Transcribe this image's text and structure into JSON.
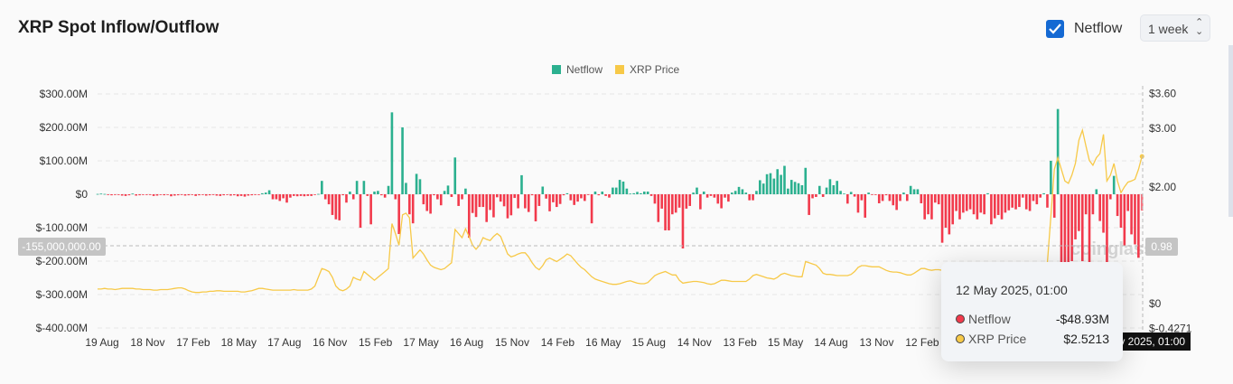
{
  "header": {
    "title": "XRP Spot Inflow/Outflow",
    "netflow_checkbox_label": "Netflow",
    "netflow_checked": true,
    "interval_select": "1 week"
  },
  "colors": {
    "positive": "#2bb08f",
    "negative": "#f23a4c",
    "price": "#f7c948",
    "checkbox": "#1469d3"
  },
  "watermark": "coinglass",
  "crosshair": {
    "left_label": "-155,000,000.00",
    "right_label": "0.98",
    "x_label": "12 May 2025, 01:00"
  },
  "tooltip": {
    "date": "12 May 2025, 01:00",
    "rows": [
      {
        "label": "Netflow",
        "value": "-$48.93M",
        "color": "#f23a4c"
      },
      {
        "label": "XRP Price",
        "value": "$2.5213",
        "color": "#f7c948"
      }
    ]
  },
  "chart_data": {
    "type": "bar+line",
    "legend": [
      {
        "name": "Netflow",
        "color": "#2bb08f"
      },
      {
        "name": "XRP Price",
        "color": "#f7c948"
      }
    ],
    "legend_position": "top-center",
    "grid": true,
    "x_start": "19 Aug 2019",
    "x_interval": "1 week",
    "x_tick_labels": [
      "19 Aug",
      "18 Nov",
      "17 Feb",
      "18 May",
      "17 Aug",
      "16 Nov",
      "15 Feb",
      "17 May",
      "16 Aug",
      "15 Nov",
      "14 Feb",
      "16 May",
      "15 Aug",
      "14 Nov",
      "13 Feb",
      "15 May",
      "14 Aug",
      "13 Nov",
      "12 Feb"
    ],
    "y_left": {
      "unit": "USD millions",
      "range": [
        -400,
        300
      ],
      "ticks": [
        {
          "v": 300,
          "label": "$300.00M"
        },
        {
          "v": 200,
          "label": "$200.00M"
        },
        {
          "v": 100,
          "label": "$100.00M"
        },
        {
          "v": 0,
          "label": "$0"
        },
        {
          "v": -100,
          "label": "$-100.00M"
        },
        {
          "v": -200,
          "label": "$-200.00M"
        },
        {
          "v": -300,
          "label": "$-300.00M"
        },
        {
          "v": -400,
          "label": "$-400.00M"
        }
      ]
    },
    "y_right": {
      "unit": "USD",
      "range": [
        -0.4271,
        3.6
      ],
      "ticks": [
        {
          "v": 3.6,
          "label": "$3.60"
        },
        {
          "v": 3.0,
          "label": "$3.00"
        },
        {
          "v": 2.0,
          "label": "$2.00"
        },
        {
          "v": 0,
          "label": "$0"
        },
        {
          "v": -0.4271,
          "label": "$-0.4271"
        }
      ]
    },
    "series": [
      {
        "name": "Netflow",
        "axis": "left",
        "values": [
          1,
          2,
          1,
          -2,
          -3,
          -2,
          -1,
          -4,
          -5,
          -3,
          2,
          -4,
          -3,
          -1,
          -2,
          -1,
          -5,
          -4,
          -2,
          -3,
          -2,
          -6,
          -4,
          -3,
          -2,
          -4,
          -3,
          -2,
          -5,
          -3,
          -2,
          -4,
          -3,
          -2,
          -4,
          -5,
          -3,
          -2,
          -4,
          -3,
          -6,
          -5,
          -7,
          -4,
          -3,
          -2,
          -1,
          3,
          5,
          12,
          -15,
          -15,
          -20,
          -12,
          -25,
          -10,
          -5,
          -6,
          -5,
          -6,
          -5,
          -5,
          -2,
          1,
          40,
          -15,
          -30,
          -62,
          -75,
          -78,
          -3,
          -25,
          8,
          -15,
          40,
          -100,
          40,
          -5,
          -90,
          8,
          10,
          -3,
          -10,
          25,
          245,
          -15,
          -119,
          200,
          34,
          -60,
          -87,
          61,
          45,
          -30,
          -50,
          -58,
          -3,
          -15,
          -33,
          10,
          26,
          -8,
          110,
          -35,
          -15,
          17,
          -130,
          -56,
          -68,
          -38,
          -38,
          -83,
          -47,
          -69,
          -9,
          -22,
          -36,
          -72,
          -63,
          -11,
          -42,
          57,
          -42,
          -53,
          -3,
          -81,
          -35,
          23,
          -13,
          -51,
          -24,
          -38,
          -29,
          -3,
          3,
          -18,
          -32,
          -22,
          -12,
          -20,
          -2,
          -87,
          8,
          -3,
          8,
          -5,
          -10,
          20,
          20,
          43,
          38,
          17,
          2,
          3,
          7,
          3,
          8,
          8,
          -5,
          -28,
          -83,
          -43,
          -108,
          -108,
          -60,
          -55,
          -40,
          -162,
          -43,
          -35,
          5,
          20,
          -45,
          8,
          -10,
          -5,
          -10,
          -28,
          -42,
          -10,
          -22,
          5,
          10,
          22,
          15,
          5,
          -18,
          -18,
          10,
          42,
          32,
          60,
          63,
          47,
          75,
          58,
          85,
          17,
          43,
          37,
          33,
          27,
          79,
          -62,
          -12,
          -8,
          25,
          -8,
          20,
          45,
          27,
          40,
          10,
          2,
          -28,
          7,
          -7,
          -55,
          -18,
          -70,
          5,
          -2,
          -2,
          -27,
          -20,
          -3,
          -20,
          -33,
          -47,
          -20,
          5,
          -20,
          25,
          15,
          15,
          -27,
          -75,
          -60,
          -75,
          -25,
          -30,
          -145,
          -100,
          -120,
          -90,
          -50,
          -75,
          -55,
          -50,
          -45,
          -60,
          -75,
          -55,
          -60,
          3,
          -90,
          -72,
          -62,
          -75,
          -55,
          -48,
          -40,
          -45,
          -38,
          -10,
          -45,
          -50,
          -20,
          -30,
          -10,
          3,
          -40,
          100,
          -70,
          255,
          -220,
          -210,
          -215,
          -200,
          -135,
          -110,
          -200,
          -60,
          -205,
          -60,
          15,
          -80,
          -115,
          -215,
          -15,
          55,
          -65,
          -100,
          -155,
          -50,
          -120,
          -150,
          -190,
          -48.93
        ]
      },
      {
        "name": "XRP Price",
        "axis": "right",
        "values": [
          0.25,
          0.25,
          0.26,
          0.25,
          0.25,
          0.24,
          0.25,
          0.26,
          0.26,
          0.26,
          0.26,
          0.25,
          0.25,
          0.24,
          0.24,
          0.24,
          0.23,
          0.23,
          0.24,
          0.24,
          0.24,
          0.25,
          0.26,
          0.27,
          0.27,
          0.25,
          0.22,
          0.2,
          0.19,
          0.19,
          0.2,
          0.2,
          0.21,
          0.21,
          0.22,
          0.22,
          0.21,
          0.21,
          0.21,
          0.21,
          0.21,
          0.2,
          0.2,
          0.21,
          0.22,
          0.24,
          0.26,
          0.26,
          0.25,
          0.24,
          0.23,
          0.23,
          0.23,
          0.23,
          0.23,
          0.23,
          0.24,
          0.23,
          0.23,
          0.23,
          0.23,
          0.25,
          0.3,
          0.45,
          0.6,
          0.58,
          0.55,
          0.45,
          0.3,
          0.24,
          0.22,
          0.25,
          0.3,
          0.45,
          0.42,
          0.4,
          0.55,
          0.5,
          0.45,
          0.4,
          0.45,
          0.5,
          0.55,
          0.6,
          1.37,
          1.2,
          1.0,
          1.52,
          1.55,
          1.47,
          0.78,
          0.85,
          0.92,
          0.85,
          0.75,
          0.66,
          0.62,
          0.6,
          0.58,
          0.6,
          0.65,
          0.7,
          1.27,
          1.2,
          1.13,
          1.28,
          1.15,
          1.0,
          0.93,
          1.0,
          1.13,
          1.1,
          1.08,
          1.15,
          1.2,
          1.15,
          1.0,
          0.85,
          0.8,
          0.82,
          0.85,
          0.87,
          0.87,
          0.8,
          0.7,
          0.62,
          0.58,
          0.65,
          0.75,
          0.78,
          0.75,
          0.72,
          0.76,
          0.8,
          0.85,
          0.82,
          0.75,
          0.68,
          0.62,
          0.58,
          0.52,
          0.46,
          0.42,
          0.4,
          0.38,
          0.36,
          0.34,
          0.33,
          0.33,
          0.34,
          0.36,
          0.38,
          0.39,
          0.37,
          0.35,
          0.34,
          0.34,
          0.36,
          0.42,
          0.48,
          0.51,
          0.53,
          0.55,
          0.52,
          0.49,
          0.49,
          0.4,
          0.35,
          0.36,
          0.37,
          0.38,
          0.38,
          0.37,
          0.36,
          0.34,
          0.33,
          0.34,
          0.37,
          0.4,
          0.4,
          0.39,
          0.38,
          0.38,
          0.38,
          0.38,
          0.38,
          0.42,
          0.48,
          0.5,
          0.48,
          0.46,
          0.44,
          0.43,
          0.42,
          0.45,
          0.5,
          0.52,
          0.5,
          0.48,
          0.47,
          0.46,
          0.46,
          0.72,
          0.7,
          0.68,
          0.66,
          0.6,
          0.52,
          0.5,
          0.5,
          0.49,
          0.48,
          0.48,
          0.48,
          0.48,
          0.5,
          0.55,
          0.62,
          0.65,
          0.65,
          0.64,
          0.63,
          0.63,
          0.63,
          0.6,
          0.57,
          0.55,
          0.54,
          0.54,
          0.53,
          0.51,
          0.49,
          0.49,
          0.52,
          0.56,
          0.6,
          0.6,
          0.58,
          0.57,
          0.58,
          0.58,
          0.57,
          0.56,
          0.55,
          0.55,
          0.55,
          0.56,
          0.57,
          0.58,
          0.58,
          0.57,
          0.56,
          0.55,
          0.54,
          0.53,
          0.53,
          0.54,
          0.55,
          0.56,
          0.57,
          0.58,
          0.58,
          0.58,
          0.59,
          0.58,
          0.57,
          0.56,
          0.55,
          0.55,
          0.56,
          0.6,
          0.7,
          1.5,
          2.3,
          2.5,
          2.3,
          2.1,
          2.06,
          2.2,
          2.4,
          2.8,
          2.97,
          2.7,
          2.45,
          2.37,
          2.5,
          2.57,
          2.9,
          2.1,
          2.2,
          2.4,
          2.1,
          1.9,
          2.0,
          2.08,
          2.1,
          2.13,
          2.3,
          2.5213
        ]
      }
    ]
  }
}
